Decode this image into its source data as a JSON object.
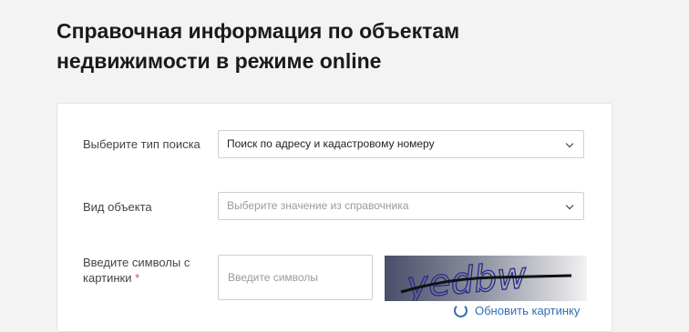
{
  "page": {
    "title_line1": "Справочная информация по объектам",
    "title_line2": "недвижимости в режиме online"
  },
  "form": {
    "search_type": {
      "label": "Выберите тип поиска",
      "value": "Поиск по адресу и кадастровому номеру"
    },
    "object_type": {
      "label": "Вид объекта",
      "placeholder": "Выберите значение из справочника"
    },
    "captcha": {
      "label": "Введите символы с картинки",
      "required_mark": "*",
      "placeholder": "Введите символы",
      "image_text": "yedbw",
      "refresh_label": "Обновить картинку"
    }
  },
  "colors": {
    "accent": "#2f6db5",
    "required": "#d9534f"
  }
}
